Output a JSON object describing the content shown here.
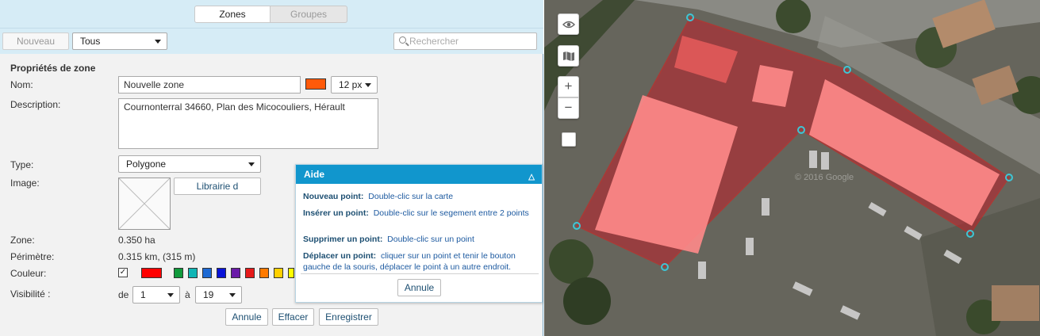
{
  "tabs": [
    {
      "label": "Zones",
      "active": true
    },
    {
      "label": "Groupes",
      "active": false
    }
  ],
  "toolbar": {
    "new_label": "Nouveau",
    "filter_value": "Tous",
    "search_placeholder": "Rechercher"
  },
  "form": {
    "section_title": "Propriétés de zone",
    "name_label": "Nom:",
    "name_value": "Nouvelle zone",
    "color_value": "#ff5a0a",
    "line_width": "12 px",
    "description_label": "Description:",
    "description_value": "Cournonterral 34660, Plan des Micocouliers, Hérault",
    "type_label": "Type:",
    "type_value": "Polygone",
    "image_label": "Image:",
    "library_button": "Librairie d",
    "zone_label": "Zone:",
    "zone_value": "0.350 ha",
    "perimeter_label": "Périmètre:",
    "perimeter_value": "0.315 km, (315 m)",
    "color_label": "Couleur:",
    "palette": [
      "#ff0000",
      "#119a3c",
      "#11b5b5",
      "#1e6ad4",
      "#0a14d8",
      "#6a1aa8",
      "#e61a1a",
      "#ff7a00",
      "#ffd000",
      "#ffff00"
    ],
    "visibility_label": "Visibilité :",
    "vis_from_label": "de",
    "vis_from_value": "1",
    "vis_to_label": "à",
    "vis_to_value": "19"
  },
  "actions": {
    "cancel": "Annule",
    "clear": "Effacer",
    "save": "Enregistrer"
  },
  "help": {
    "title": "Aide",
    "items": [
      {
        "term": "Nouveau point:",
        "text": "Double-clic sur la carte"
      },
      {
        "term": "Insérer un point:",
        "text": "Double-clic sur le segement entre 2 points"
      },
      {
        "term": "Supprimer un point:",
        "text": "Double-clic sur un point"
      },
      {
        "term": "Déplacer un point:",
        "text": "cliquer sur un point et tenir le bouton gauche de la souris, déplacer le point à un autre endroit."
      }
    ],
    "close_label": "Annule"
  },
  "map": {
    "controls": [
      "eye-icon",
      "map-icon",
      "zoom-in",
      "zoom-out",
      "square"
    ],
    "watermark": "© 2016 Google",
    "zone_fill": "#ff3030",
    "vertex_color": "#3ec6d6"
  }
}
